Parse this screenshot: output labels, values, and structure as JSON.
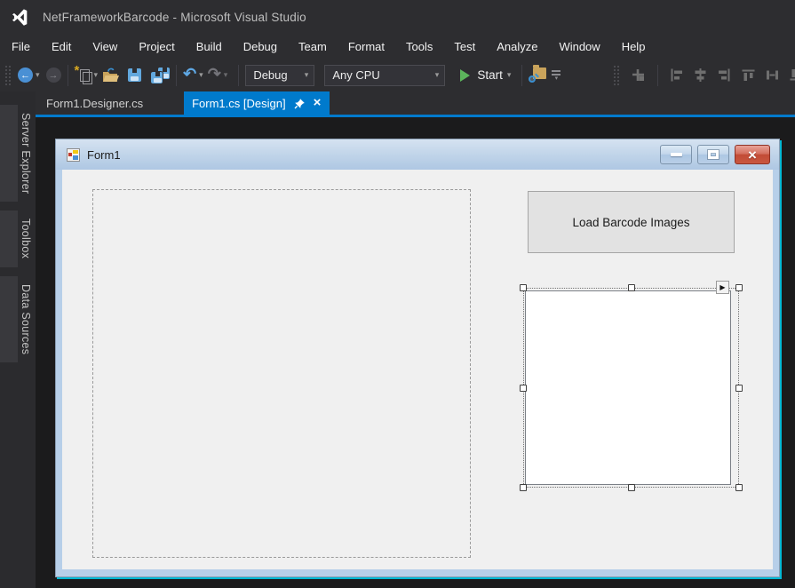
{
  "titlebar": {
    "title": "NetFrameworkBarcode - Microsoft Visual Studio"
  },
  "menu": {
    "items": [
      "File",
      "Edit",
      "View",
      "Project",
      "Build",
      "Debug",
      "Team",
      "Format",
      "Tools",
      "Test",
      "Analyze",
      "Window",
      "Help"
    ]
  },
  "toolbar": {
    "config_selector": "Debug",
    "platform_selector": "Any CPU",
    "start_label": "Start"
  },
  "editor_tabs": {
    "inactive_tab": "Form1.Designer.cs",
    "active_tab": "Form1.cs [Design]"
  },
  "side_tabs": {
    "items": [
      "Server Explorer",
      "Toolbox",
      "Data Sources"
    ]
  },
  "designer_form": {
    "title": "Form1",
    "load_button_label": "Load Barcode Images"
  },
  "glyphs": {
    "back_arrow": "←",
    "forward_arrow": "→",
    "undo": "↶",
    "redo": "↷",
    "caret_down": "▾",
    "tab_close": "×",
    "window_close": "×",
    "smart_tag": "▶",
    "new_file_star": "*"
  },
  "colors": {
    "accent_blue": "#007acc",
    "chrome_dark": "#2d2d30",
    "designer_background": "#1b1b1c",
    "form_border_blue": "#b7cfe9",
    "form_client_gray": "#f0f0f0",
    "start_green": "#5cb55c",
    "close_button_red": "#c24b36",
    "selection_glow_cyan": "#00b8d4"
  }
}
